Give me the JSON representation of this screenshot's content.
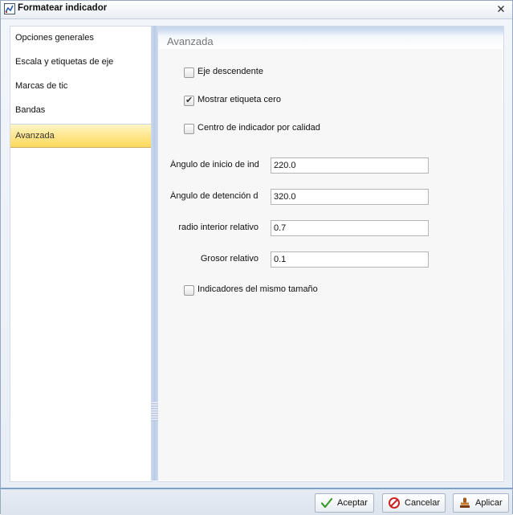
{
  "window": {
    "title": "Formatear indicador"
  },
  "icons": {
    "title": "gauge-format-icon",
    "close": "close-icon"
  },
  "nav": {
    "items": [
      {
        "label": "Opciones generales"
      },
      {
        "label": "Escala y etiquetas de eje"
      },
      {
        "label": "Marcas de tic"
      },
      {
        "label": "Bandas"
      },
      {
        "label": "Avanzada",
        "selected": true
      }
    ]
  },
  "section": {
    "title": "Avanzada"
  },
  "options": {
    "descending_axis": {
      "label": "Eje descendente",
      "checked": false
    },
    "show_zero_label": {
      "label": "Mostrar etiqueta cero",
      "checked": true
    },
    "center_by_quality": {
      "label": "Centro de indicador por calidad",
      "checked": false
    },
    "same_size": {
      "label": "Indicadores del mismo tamaño",
      "checked": false
    }
  },
  "fields": {
    "start_angle": {
      "label": "Ángulo de inicio de indicador",
      "value": "220.0"
    },
    "stop_angle": {
      "label": "Ángulo de detención de indicador",
      "value": "320.0"
    },
    "inner_radius": {
      "label": "radio interior relativo",
      "value": "0.7"
    },
    "thickness": {
      "label": "Grosor relativo",
      "value": "0.1"
    }
  },
  "footer": {
    "ok_label": "Aceptar",
    "cancel_label": "Cancelar",
    "apply_label": "Aplicar"
  },
  "colors": {
    "selected_nav": "#fcd95b",
    "accent": "#7ea0cc",
    "ok_check": "#3a9a2a",
    "cancel_red": "#cc2222"
  }
}
